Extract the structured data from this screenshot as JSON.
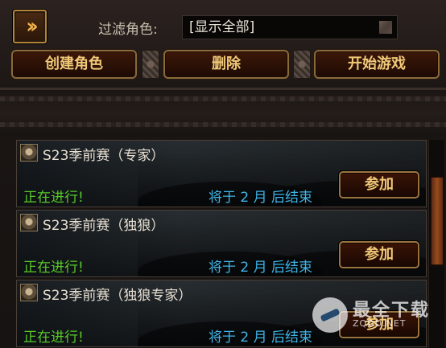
{
  "toolbar": {
    "expand_icon": "double-chevron-right",
    "filter_label": "过滤角色:",
    "filter_value": "[显示全部]",
    "create_label": "创建角色",
    "delete_label": "删除",
    "start_label": "开始游戏"
  },
  "events": [
    {
      "name": "S23季前赛（专家）",
      "status": "正在进行!",
      "ends": "将于 2 月 后结束",
      "join_label": "参加"
    },
    {
      "name": "S23季前赛（独狼）",
      "status": "正在进行!",
      "ends": "将于 2 月 后结束",
      "join_label": "参加"
    },
    {
      "name": "S23季前赛（独狼专家）",
      "status": "正在进行!",
      "ends": "将于 2 月 后结束",
      "join_label": "参加"
    }
  ],
  "watermark": {
    "text": "最全下载",
    "url": "ZQDD.NET"
  },
  "colors": {
    "status_green": "#57c92a",
    "ends_blue": "#3fb4e8",
    "button_gold": "#f0c878"
  }
}
